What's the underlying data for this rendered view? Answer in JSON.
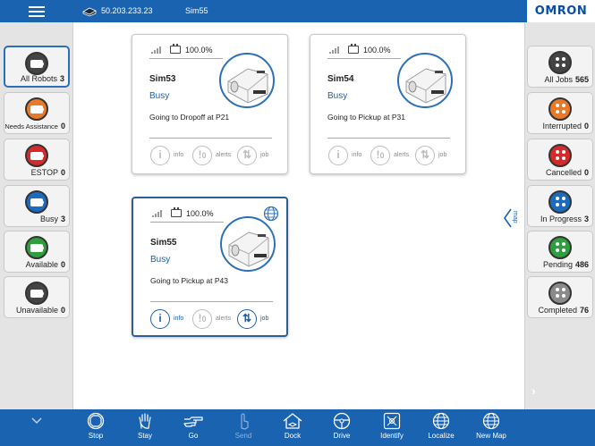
{
  "topbar": {
    "ip": "50.203.233.23",
    "robot": "Sim55",
    "logo": "OMRON"
  },
  "left_panel": [
    {
      "label": "All Robots",
      "count": "3",
      "color": "#444444",
      "selected": true
    },
    {
      "label": "Needs Assistance",
      "count": "0",
      "color": "#e8792a"
    },
    {
      "label": "ESTOP",
      "count": "0",
      "color": "#d42a2a"
    },
    {
      "label": "Busy",
      "count": "3",
      "color": "#1d6bbf"
    },
    {
      "label": "Available",
      "count": "0",
      "color": "#2e9e3e"
    },
    {
      "label": "Unavailable",
      "count": "0",
      "color": "#444444"
    }
  ],
  "right_panel": [
    {
      "label": "All Jobs",
      "count": "565",
      "color": "#444444"
    },
    {
      "label": "Interrupted",
      "count": "0",
      "color": "#e8792a"
    },
    {
      "label": "Cancelled",
      "count": "0",
      "color": "#d42a2a"
    },
    {
      "label": "In Progress",
      "count": "3",
      "color": "#1d6bbf"
    },
    {
      "label": "Pending",
      "count": "486",
      "color": "#2e9e3e"
    },
    {
      "label": "Completed",
      "count": "76",
      "color": "#8a8a8a"
    }
  ],
  "map_tab": {
    "label": "map"
  },
  "cards": [
    {
      "battery": "100.0%",
      "name": "Sim53",
      "status": "Busy",
      "task": "Going to Dropoff at P21",
      "info": "info",
      "alerts": "alerts",
      "alerts_count": "0",
      "job": "job"
    },
    {
      "battery": "100.0%",
      "name": "Sim54",
      "status": "Busy",
      "task": "Going to Pickup at P31",
      "info": "info",
      "alerts": "alerts",
      "alerts_count": "0",
      "job": "job"
    },
    {
      "battery": "100.0%",
      "name": "Sim55",
      "status": "Busy",
      "task": "Going to Pickup at P43",
      "info": "info",
      "alerts": "alerts",
      "alerts_count": "0",
      "job": "job",
      "selected": true
    }
  ],
  "toolbar": {
    "stop": "Stop",
    "stay": "Stay",
    "go": "Go",
    "send": "Send",
    "dock": "Dock",
    "drive": "Drive",
    "identify": "Identify",
    "localize": "Localize",
    "new_map": "New Map"
  },
  "colors": {
    "accent": "#1a63b0",
    "panel": "#e4e4e4",
    "status_text": "#1d5fa3"
  }
}
